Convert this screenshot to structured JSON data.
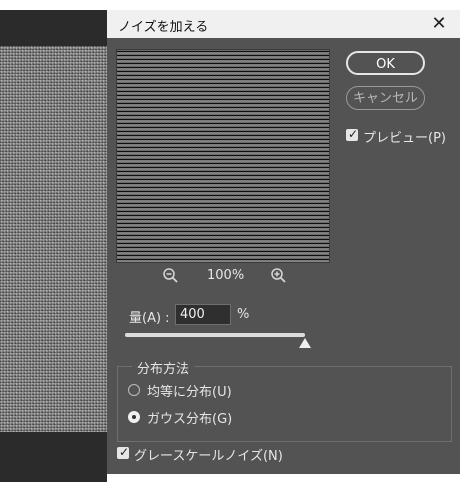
{
  "dialog": {
    "title": "ノイズを加える",
    "close_glyph": "✕"
  },
  "preview": {
    "zoom_out_icon": "zoom-out-icon",
    "zoom_in_icon": "zoom-in-icon",
    "zoom_level": "100%"
  },
  "buttons": {
    "ok_label": "OK",
    "cancel_label": "キャンセル"
  },
  "preview_toggle": {
    "label": "プレビュー(P)",
    "checked": true
  },
  "amount": {
    "label": "量(A) :",
    "value": "400",
    "unit": "%",
    "slider_fraction": 1.0
  },
  "distribution": {
    "title": "分布方法",
    "options": [
      {
        "label": "均等に分布(U)",
        "selected": false
      },
      {
        "label": "ガウス分布(G)",
        "selected": true
      }
    ]
  },
  "monochromatic": {
    "label": "グレースケールノイズ(N)",
    "checked": true
  },
  "colors": {
    "dialog_bg": "#535353",
    "titlebar_bg": "#f0f0f0",
    "text": "#e6e6e6"
  }
}
